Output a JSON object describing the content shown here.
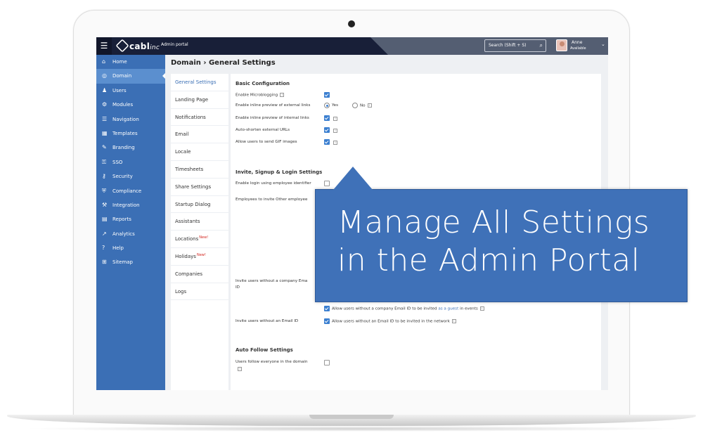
{
  "topbar": {
    "menu_icon": "hamburger-icon",
    "logo_text": "cabl",
    "logo_suffix": "inc",
    "portal_label": "Admin portal",
    "search_placeholder": "Search (Shift + S)",
    "user_name": "Anne",
    "user_status": "Available"
  },
  "sidebar": {
    "items": [
      {
        "label": "Home",
        "icon": "home-icon",
        "glyph": "⌂"
      },
      {
        "label": "Domain",
        "icon": "globe-icon",
        "glyph": "◎"
      },
      {
        "label": "Users",
        "icon": "users-icon",
        "glyph": "♟"
      },
      {
        "label": "Modules",
        "icon": "modules-icon",
        "glyph": "⚙"
      },
      {
        "label": "Navigation",
        "icon": "navigation-icon",
        "glyph": "☰"
      },
      {
        "label": "Templates",
        "icon": "templates-icon",
        "glyph": "▦"
      },
      {
        "label": "Branding",
        "icon": "branding-icon",
        "glyph": "✎"
      },
      {
        "label": "SSO",
        "icon": "sso-icon",
        "glyph": "⚿"
      },
      {
        "label": "Security",
        "icon": "key-icon",
        "glyph": "⚷"
      },
      {
        "label": "Compliance",
        "icon": "shield-icon",
        "glyph": "⛨"
      },
      {
        "label": "Integration",
        "icon": "plug-icon",
        "glyph": "⚒"
      },
      {
        "label": "Reports",
        "icon": "reports-icon",
        "glyph": "▤"
      },
      {
        "label": "Analytics",
        "icon": "analytics-icon",
        "glyph": "↗"
      },
      {
        "label": "Help",
        "icon": "help-icon",
        "glyph": "?"
      },
      {
        "label": "Sitemap",
        "icon": "sitemap-icon",
        "glyph": "⊞"
      }
    ]
  },
  "main": {
    "breadcrumb": "Domain › General Settings",
    "subnav": [
      {
        "label": "General Settings",
        "new": ""
      },
      {
        "label": "Landing Page",
        "new": ""
      },
      {
        "label": "Notifications",
        "new": ""
      },
      {
        "label": "Email",
        "new": ""
      },
      {
        "label": "Locale",
        "new": ""
      },
      {
        "label": "Timesheets",
        "new": ""
      },
      {
        "label": "Share Settings",
        "new": ""
      },
      {
        "label": "Startup Dialog",
        "new": ""
      },
      {
        "label": "Assistants",
        "new": ""
      },
      {
        "label": "Locations",
        "new": "New!"
      },
      {
        "label": "Holidays",
        "new": "New!"
      },
      {
        "label": "Companies",
        "new": ""
      },
      {
        "label": "Logs",
        "new": ""
      }
    ],
    "basic": {
      "title": "Basic Configuration",
      "microblogging": "Enable Microblogging",
      "external_links": "Enable inline preview of external links",
      "yes": "Yes",
      "no": "No",
      "internal_links": "Enable inline preview of internal links",
      "auto_shorten": "Auto-shorten external URLs",
      "gif": "Allow users to send GIF images"
    },
    "invite": {
      "title": "Invite, Signup & Login Settings",
      "employee_id": "Enable login using employee identifier",
      "invite_other": "Employees to invite Other employee",
      "no_company_email_a": "Invite users without a company Ema",
      "no_company_email_b": "ID",
      "guest_opt_prefix": "Allow users without a company Email ID to be invited",
      "guest_link": "as a guest",
      "guest_opt_suffix": "in events",
      "no_email": "Invite users without an Email ID",
      "no_email_opt": "Allow users without an Email ID to be invited in the network"
    },
    "follow": {
      "title": "Auto Follow Settings",
      "everyone": "Users follow everyone in the domain"
    }
  },
  "callout": {
    "line1": "Manage All Settings",
    "line2": "in the Admin Portal"
  }
}
